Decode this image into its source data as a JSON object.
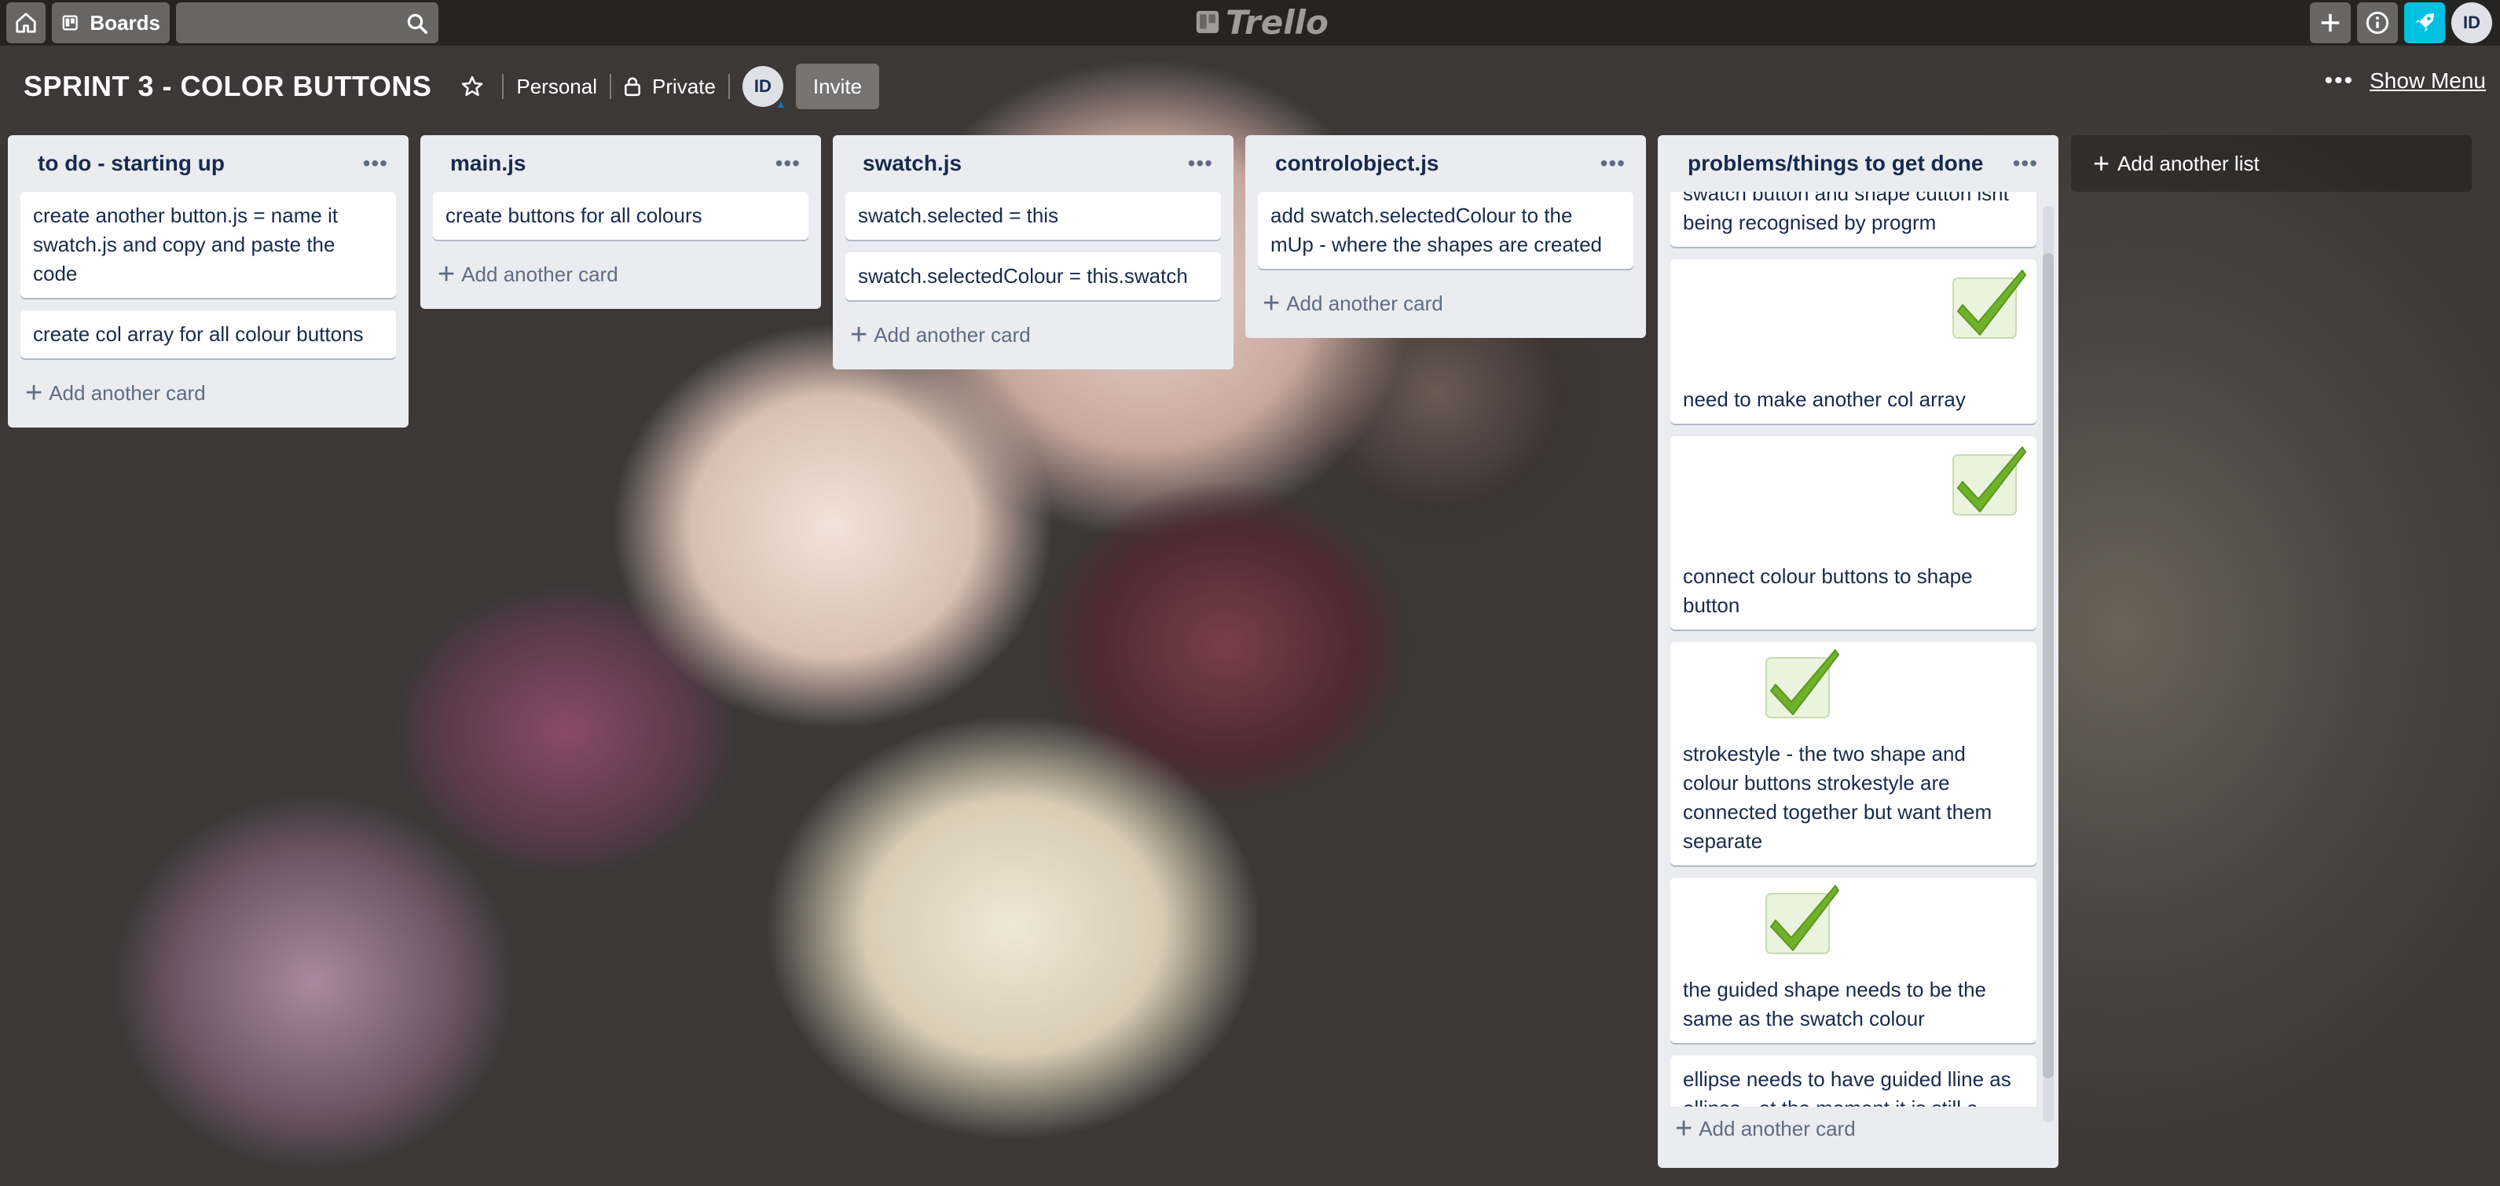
{
  "header": {
    "boards_label": "Boards",
    "search_value": "",
    "logo_text": "Trello",
    "user_initials": "ID"
  },
  "board": {
    "title": "SPRINT 3 - COLOR BUTTONS",
    "team": "Personal",
    "visibility": "Private",
    "member_initials": "ID",
    "invite_label": "Invite",
    "show_menu_label": "Show Menu"
  },
  "lists": [
    {
      "title": "to do - starting up",
      "cards": [
        "create another button.js = name it swatch.js and copy and paste the code",
        "create col array for all colour buttons"
      ],
      "add_card_label": "Add another card"
    },
    {
      "title": "main.js",
      "cards": [
        "create buttons for all colours"
      ],
      "add_card_label": "Add another card"
    },
    {
      "title": "swatch.js",
      "cards": [
        "swatch.selected = this",
        "swatch.selectedColour = this.swatch"
      ],
      "add_card_label": "Add another card"
    },
    {
      "title": "controlobject.js",
      "cards": [
        "add swatch.selectedColour to the mUp - where the shapes are created"
      ],
      "add_card_label": "Add another card"
    },
    {
      "title": "problems/things to get done",
      "cards": [
        "swatch button and shape cutton isnt being recognised by progrm",
        "need to make another col array",
        "connect colour buttons to shape button",
        "strokestyle - the two shape and colour buttons strokestyle are connected together but want them separate",
        "the guided shape needs to be the same as the swatch colour",
        "ellipse needs to have guided lline as ellipse - at the moment it is still a guided rectangle rather than guided ellipse"
      ],
      "add_card_label": "Add another card"
    }
  ],
  "add_list_label": "Add another list",
  "colors": {
    "accent": "#00c2e0",
    "list_bg": "#ebecf0",
    "check_green": "#6fb22a"
  }
}
